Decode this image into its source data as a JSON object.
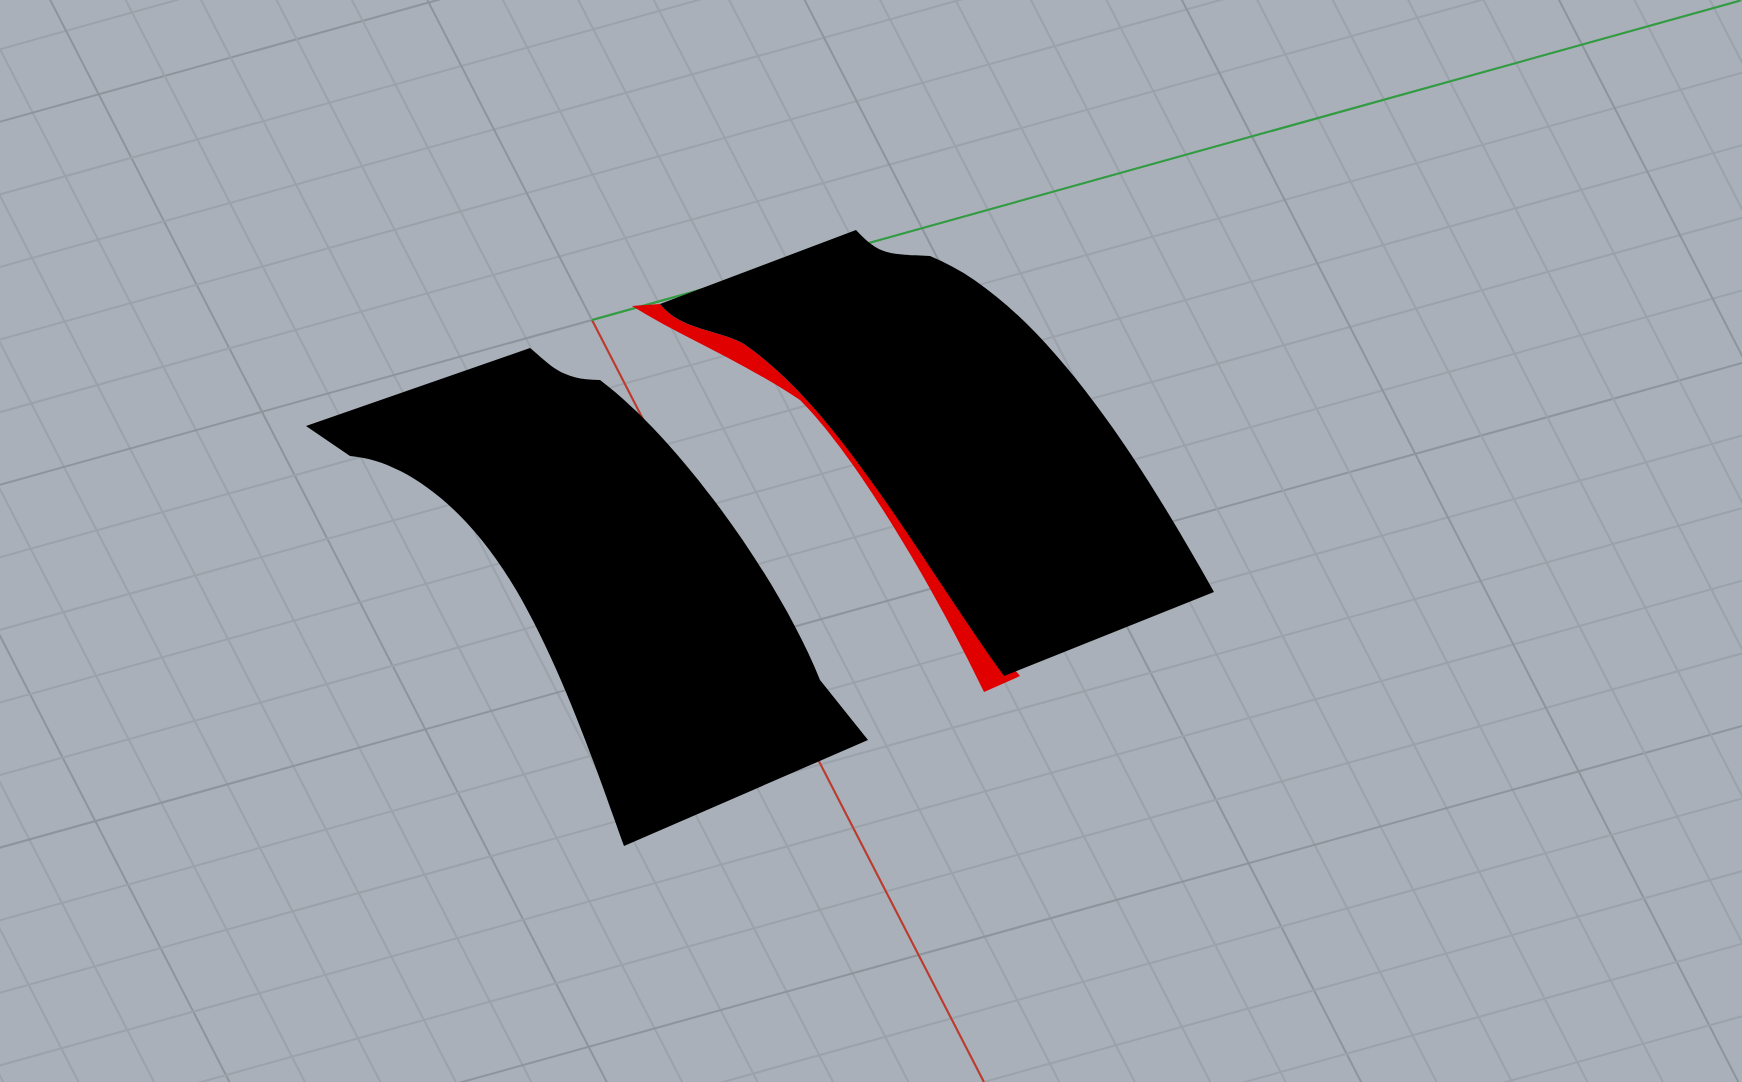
{
  "viewport": {
    "axes": [
      {
        "kind": "x",
        "color": "#c0392b"
      },
      {
        "kind": "y",
        "color": "#2e9e3e"
      }
    ]
  }
}
